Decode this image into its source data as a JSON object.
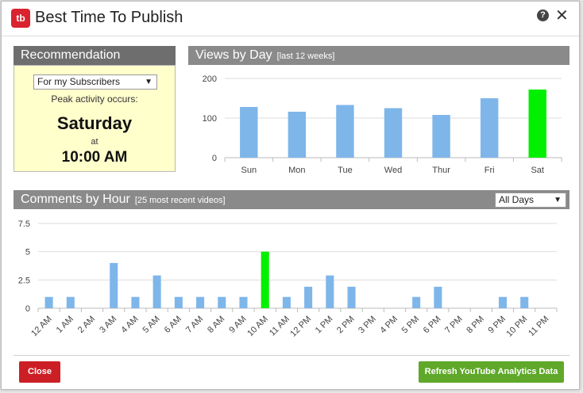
{
  "window": {
    "logo_text": "tb",
    "title": "Best Time To Publish",
    "help_icon": "?",
    "close_icon": "✕"
  },
  "recommendation": {
    "header": "Recommendation",
    "audience_select": "For my Subscribers",
    "peak_label": "Peak activity occurs:",
    "day": "Saturday",
    "at_label": "at",
    "time": "10:00 AM"
  },
  "views_by_day": {
    "header": "Views by Day",
    "subheader": "[last 12 weeks]"
  },
  "comments_by_hour": {
    "header": "Comments by Hour",
    "subheader": "[25 most recent videos]",
    "days_select": "All Days"
  },
  "chart_data": [
    {
      "type": "bar",
      "title": "Views by Day",
      "categories": [
        "Sun",
        "Mon",
        "Tue",
        "Wed",
        "Thur",
        "Fri",
        "Sat"
      ],
      "values": [
        128,
        116,
        133,
        125,
        108,
        150,
        172
      ],
      "highlight_index": 6,
      "ylim": [
        0,
        200
      ],
      "yticks": [
        "0",
        "100",
        "200"
      ],
      "colors": {
        "bar": "#7eb6ea",
        "highlight": "#00f000"
      },
      "grid": true
    },
    {
      "type": "bar",
      "title": "Comments by Hour",
      "categories": [
        "12 AM",
        "1 AM",
        "2 AM",
        "3 AM",
        "4 AM",
        "5 AM",
        "6 AM",
        "7 AM",
        "8 AM",
        "9 AM",
        "10 AM",
        "11 AM",
        "12 PM",
        "1 PM",
        "2 PM",
        "3 PM",
        "4 PM",
        "5 PM",
        "6 PM",
        "7 PM",
        "8 PM",
        "9 PM",
        "10 PM",
        "11 PM"
      ],
      "values": [
        1,
        1,
        0,
        4,
        1,
        2.9,
        1,
        1,
        1,
        1,
        5,
        1,
        1.9,
        2.9,
        1.9,
        0,
        0,
        1,
        1.9,
        0,
        0,
        1,
        1,
        0
      ],
      "highlight_index": 10,
      "ylim": [
        0,
        7.5
      ],
      "yticks": [
        "0",
        "2.5",
        "5",
        "7.5"
      ],
      "colors": {
        "bar": "#7eb6ea",
        "highlight": "#00f000"
      },
      "grid": true
    }
  ],
  "footer": {
    "close_label": "Close",
    "refresh_label": "Refresh YouTube Analytics Data"
  }
}
